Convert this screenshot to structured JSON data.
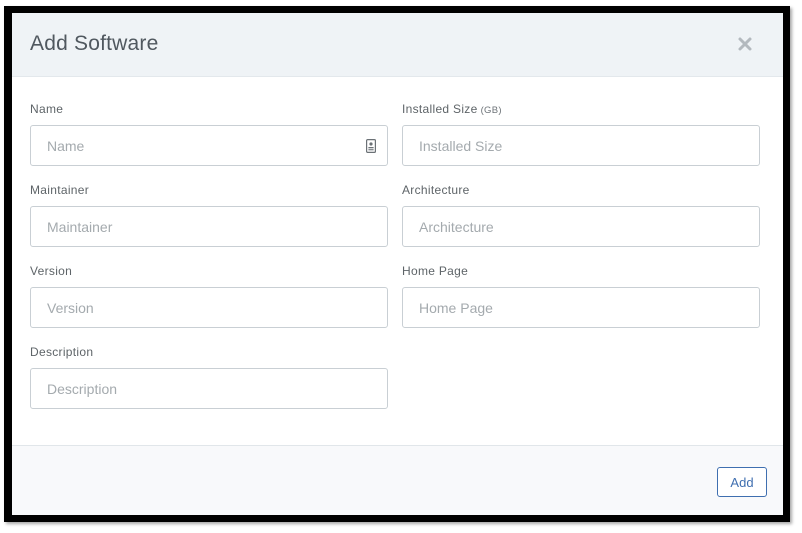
{
  "modal": {
    "title": "Add Software",
    "close_icon": "close-icon"
  },
  "form": {
    "name": {
      "label": "Name",
      "placeholder": "Name",
      "value": ""
    },
    "installed_size": {
      "label": "Installed Size",
      "unit": "(GB)",
      "placeholder": "Installed Size",
      "value": ""
    },
    "maintainer": {
      "label": "Maintainer",
      "placeholder": "Maintainer",
      "value": ""
    },
    "architecture": {
      "label": "Architecture",
      "placeholder": "Architecture",
      "value": ""
    },
    "version": {
      "label": "Version",
      "placeholder": "Version",
      "value": ""
    },
    "home_page": {
      "label": "Home Page",
      "placeholder": "Home Page",
      "value": ""
    },
    "description": {
      "label": "Description",
      "placeholder": "Description",
      "value": ""
    }
  },
  "footer": {
    "add_label": "Add"
  },
  "colors": {
    "header_bg": "#eff3f6",
    "accent": "#3f6fb0",
    "border": "#c9cfd4",
    "title_text": "#50585f"
  }
}
